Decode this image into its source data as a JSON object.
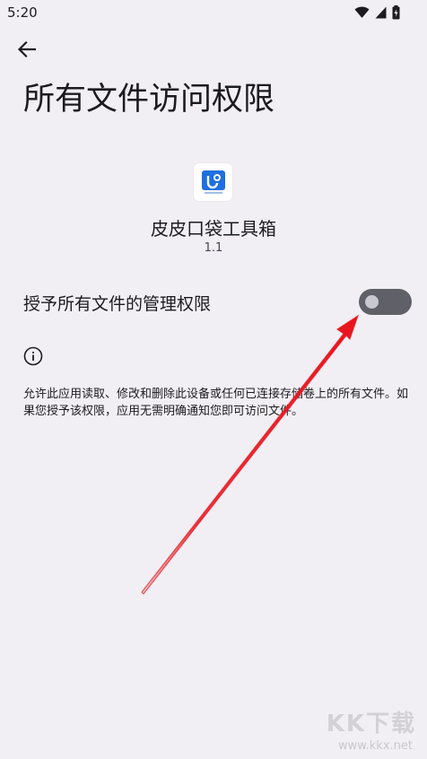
{
  "status_bar": {
    "time": "5:20",
    "icons": [
      "wifi-icon",
      "cellular-signal-icon",
      "battery-icon"
    ]
  },
  "header": {
    "back_icon": "arrow-back-icon",
    "title": "所有文件访问权限"
  },
  "app": {
    "icon": "app-logo-icon",
    "name": "皮皮口袋工具箱",
    "version": "1.1"
  },
  "setting": {
    "label": "授予所有文件的管理权限",
    "toggle_state": "off"
  },
  "info": {
    "icon": "info-icon",
    "description": "允许此应用读取、修改和删除此设备或任何已连接存储卷上的所有文件。如果您授予该权限，应用无需明确通知您即可访问文件。"
  },
  "annotation": {
    "type": "arrow",
    "color": "#e8141c",
    "points_to": "toggle"
  },
  "watermark": {
    "text": "KK下载",
    "url": "www.kkx.net"
  },
  "colors": {
    "background": "#f1eff4",
    "toggle_track_off": "#5f6068",
    "toggle_thumb_off": "#c9c8d0",
    "app_icon_accent": "#1e6fe0"
  }
}
